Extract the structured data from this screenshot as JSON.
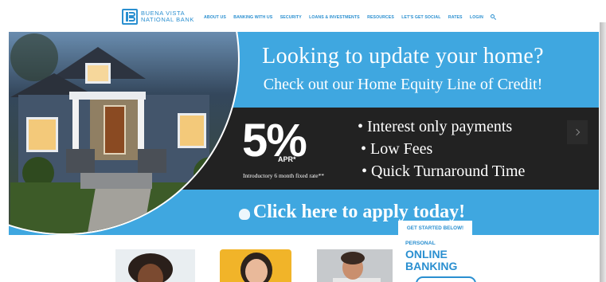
{
  "header": {
    "logo_line1": "BUENA VISTA",
    "logo_line2": "NATIONAL BANK",
    "nav": [
      {
        "label": "ABOUT US"
      },
      {
        "label": "BANKING WITH US"
      },
      {
        "label": "SECURITY"
      },
      {
        "label": "LOANS & INVESTMENTS"
      },
      {
        "label": "RESOURCES"
      },
      {
        "label": "LET'S GET SOCIAL"
      },
      {
        "label": "RATES"
      },
      {
        "label": "LOGIN"
      }
    ],
    "search_icon": "search-icon"
  },
  "hero": {
    "headline": "Looking to update your home?",
    "subhead": "Check out our Home Equity Line of Credit!",
    "rate": "5%",
    "rate_suffix": "APR*",
    "rate_note": "Introductory 6 month fixed rate**",
    "bullets": [
      "• Interest only payments",
      "• Low Fees",
      "• Quick Turnaround Time"
    ],
    "cta": "Click here to apply today!",
    "next_icon": "chevron-right-icon"
  },
  "sidebar_card": {
    "tab": "GET STARTED BELOW!",
    "label_small": "PERSONAL",
    "label_large": "ONLINE BANKING"
  },
  "colors": {
    "brand_blue": "#2a8fd0",
    "hero_blue": "#3fa7e0",
    "band_dark": "#222222"
  }
}
